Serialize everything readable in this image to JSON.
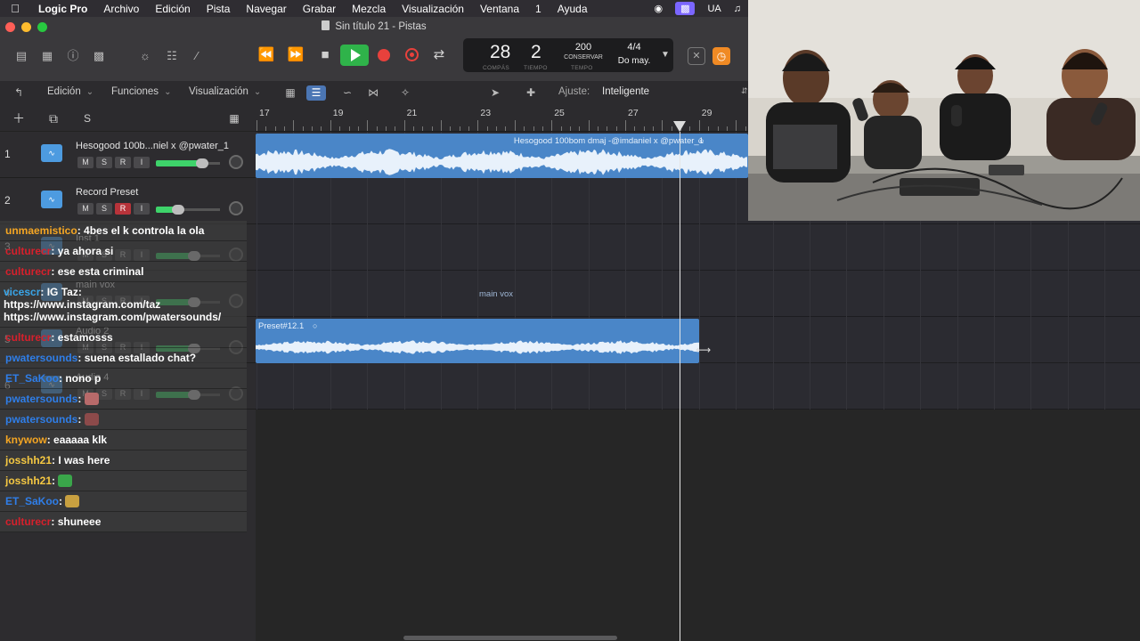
{
  "menubar": {
    "app": "Logic Pro",
    "items": [
      "Archivo",
      "Edición",
      "Pista",
      "Navegar",
      "Grabar",
      "Mezcla",
      "Visualización",
      "Ventana",
      "1",
      "Ayuda"
    ],
    "right_ua": "UA"
  },
  "window": {
    "title": "Sin título 21 - Pistas"
  },
  "lcd": {
    "bar": "28",
    "beat": "2",
    "bar_caption": "COMPÁS",
    "beat_caption": "TIEMPO",
    "tempo": "200",
    "tempo_mode": "CONSERVAR",
    "tempo_caption": "TEMPO",
    "signature": "4/4",
    "key": "Do may."
  },
  "edit_toolbar": {
    "edicion": "Edición",
    "funciones": "Funciones",
    "visualizacion": "Visualización",
    "ajuste_label": "Ajuste:",
    "ajuste_value": "Inteligente"
  },
  "track_header": {
    "solo_label": "S"
  },
  "ruler": {
    "bars": [
      "17",
      "19",
      "21",
      "23",
      "25",
      "27",
      "29"
    ]
  },
  "tracks": [
    {
      "num": "1",
      "name": "Hesogood 100b...niel x @pwater_1",
      "m": "M",
      "s": "S",
      "r": "R",
      "i": "I",
      "level": 0.72
    },
    {
      "num": "2",
      "name": "Record Preset",
      "m": "M",
      "s": "S",
      "r": "R",
      "i": "I",
      "level": 0.35
    },
    {
      "num": "3",
      "name": "Inst 1",
      "m": "M",
      "s": "S",
      "r": "R",
      "i": "I",
      "level": 0.6
    },
    {
      "num": "4",
      "name": "main vox",
      "m": "M",
      "s": "S",
      "r": "R",
      "i": "I",
      "level": 0.6
    },
    {
      "num": "5",
      "name": "Audio 2",
      "m": "M",
      "s": "S",
      "r": "R",
      "i": "I",
      "level": 0.6
    },
    {
      "num": "6",
      "name": "Audio 4",
      "m": "M",
      "s": "S",
      "r": "R",
      "i": "I",
      "level": 0.6
    }
  ],
  "regions": {
    "region1": "Hesogood 100bom dmaj -@imdaniel x @pwater_1",
    "region2": "Preset#12.1",
    "lane4_label": "main vox"
  },
  "chat": [
    {
      "user": "unmaemistico",
      "color": "#f5a623",
      "text": ": 4bes el k controla la ola"
    },
    {
      "user": "culturecr",
      "color": "#d6202c",
      "text": ": ya ahora si"
    },
    {
      "user": "culturecr",
      "color": "#d6202c",
      "text": ": ese esta criminal"
    },
    {
      "user": "vicescr",
      "color": "#39a5e8",
      "text": ": IG Taz: https://www.instagram.com/taz https://www.instagram.com/pwatersounds/"
    },
    {
      "user": "culturecr",
      "color": "#d6202c",
      "text": ": estamosss"
    },
    {
      "user": "pwatersounds",
      "color": "#2f7ee8",
      "text": ": suena estallado chat?"
    },
    {
      "user": "ET_SaKoo",
      "color": "#2f7ee8",
      "text": ": nono p"
    },
    {
      "user": "pwatersounds",
      "color": "#2f7ee8",
      "text": ":"
    },
    {
      "user": "pwatersounds",
      "color": "#2f7ee8",
      "text": ":"
    },
    {
      "user": "knywow",
      "color": "#f5a623",
      "text": ": eaaaaa klk"
    },
    {
      "user": "josshh21",
      "color": "#f5c842",
      "text": ": I was here"
    },
    {
      "user": "josshh21",
      "color": "#f5c842",
      "text": ":"
    },
    {
      "user": "ET_SaKoo",
      "color": "#2f7ee8",
      "text": ":"
    },
    {
      "user": "culturecr",
      "color": "#d6202c",
      "text": ": shuneee"
    }
  ],
  "colors": {
    "region": "#4a86c8",
    "play": "#2fb34a",
    "record": "#e8413c",
    "menubar_pill": "#7b66ff"
  }
}
